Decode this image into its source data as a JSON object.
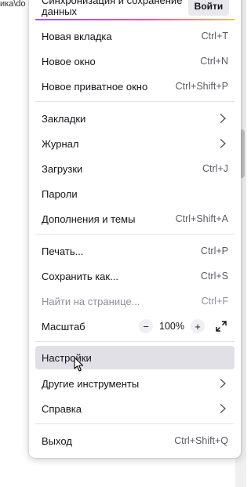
{
  "background": {
    "path_fragment": "ика\\do"
  },
  "sync": {
    "text_line1": "Синхронизация и сохранение",
    "text_line2": "данных",
    "login_label": "Войти"
  },
  "menu": {
    "new_tab": {
      "label": "Новая вкладка",
      "shortcut": "Ctrl+T"
    },
    "new_window": {
      "label": "Новое окно",
      "shortcut": "Ctrl+N"
    },
    "new_private_window": {
      "label": "Новое приватное окно",
      "shortcut": "Ctrl+Shift+P"
    },
    "bookmarks": {
      "label": "Закладки"
    },
    "history": {
      "label": "Журнал"
    },
    "downloads": {
      "label": "Загрузки",
      "shortcut": "Ctrl+J"
    },
    "passwords": {
      "label": "Пароли"
    },
    "addons": {
      "label": "Дополнения и темы",
      "shortcut": "Ctrl+Shift+A"
    },
    "print": {
      "label": "Печать...",
      "shortcut": "Ctrl+P"
    },
    "save_as": {
      "label": "Сохранить как...",
      "shortcut": "Ctrl+S"
    },
    "find": {
      "label": "Найти на странице...",
      "shortcut": "Ctrl+F",
      "disabled": true
    },
    "zoom": {
      "label": "Масштаб",
      "minus": "−",
      "level": "100%",
      "plus": "+"
    },
    "settings": {
      "label": "Настройки",
      "hovered": true
    },
    "more_tools": {
      "label": "Другие инструменты"
    },
    "help": {
      "label": "Справка"
    },
    "exit": {
      "label": "Выход",
      "shortcut": "Ctrl+Shift+Q"
    }
  },
  "icons": {
    "submenu": "chevron-right-icon",
    "fullscreen": "fullscreen-icon",
    "cursor": "mouse-pointer-icon"
  },
  "colors": {
    "menu_bg": "#ffffff",
    "hover_bg": "#e0e0e6",
    "text": "#15141a",
    "shortcut_text": "#5b5b66",
    "disabled_text": "#8f8f9d",
    "separator": "#e0e0e6"
  }
}
